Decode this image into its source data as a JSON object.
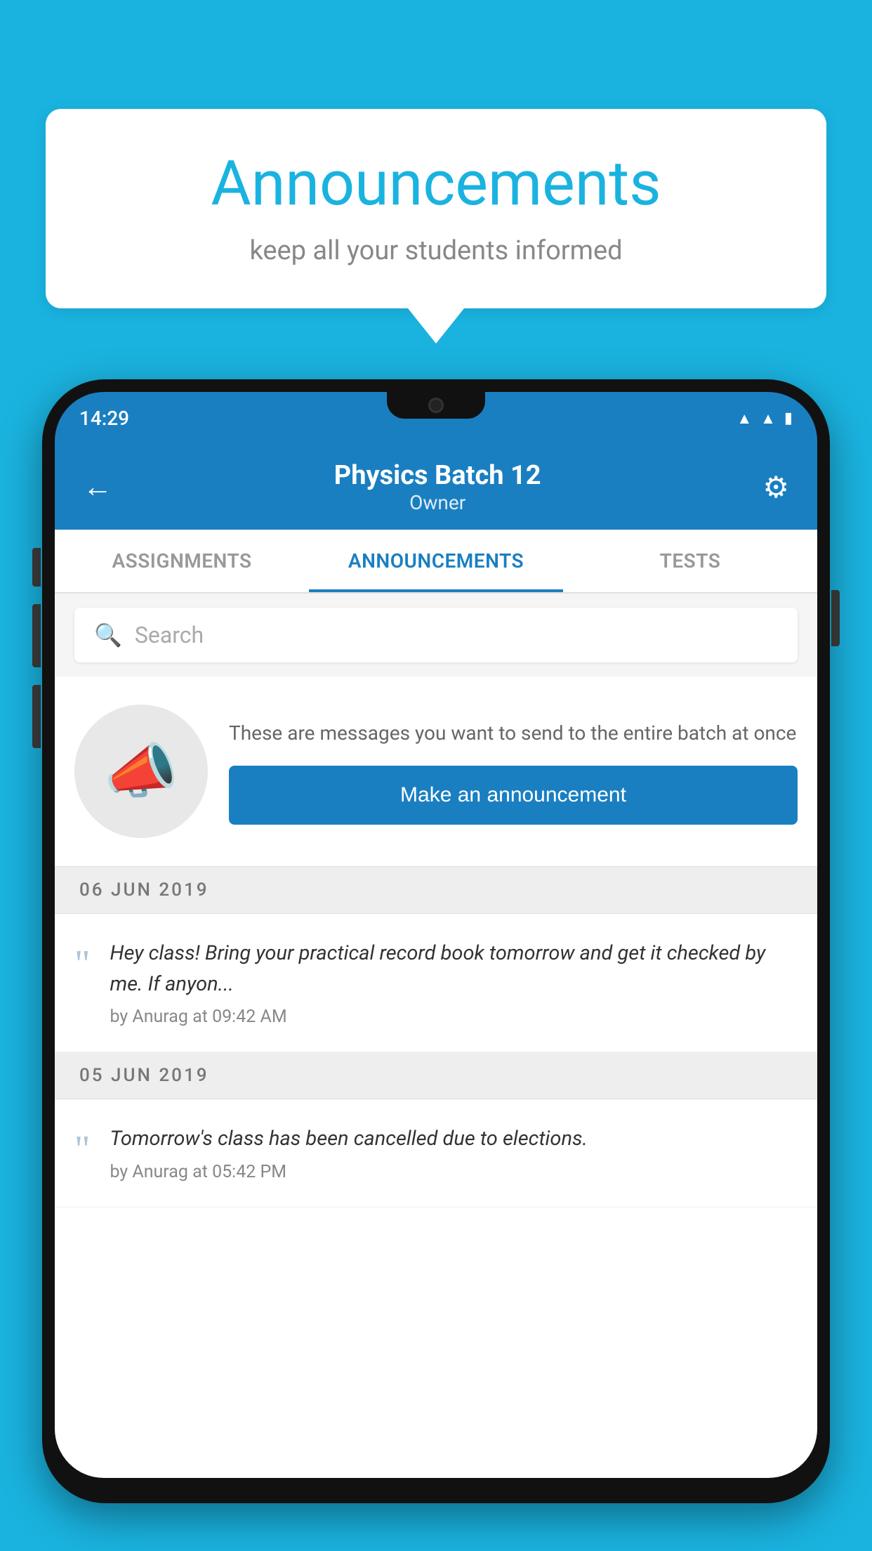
{
  "bubble": {
    "title": "Announcements",
    "subtitle": "keep all your students informed"
  },
  "status_bar": {
    "time": "14:29",
    "icons": [
      "wifi",
      "signal",
      "battery"
    ]
  },
  "header": {
    "title": "Physics Batch 12",
    "subtitle": "Owner",
    "back_label": "←",
    "settings_label": "⚙"
  },
  "tabs": [
    {
      "label": "ASSIGNMENTS",
      "active": false
    },
    {
      "label": "ANNOUNCEMENTS",
      "active": true
    },
    {
      "label": "TESTS",
      "active": false
    }
  ],
  "search": {
    "placeholder": "Search"
  },
  "announcement_prompt": {
    "description": "These are messages you want to send to the entire batch at once",
    "button_label": "Make an announcement"
  },
  "announcements": [
    {
      "date": "06  JUN  2019",
      "text": "Hey class! Bring your practical record book tomorrow and get it checked by me. If anyon...",
      "meta": "by Anurag at 09:42 AM"
    },
    {
      "date": "05  JUN  2019",
      "text": "Tomorrow's class has been cancelled due to elections.",
      "meta": "by Anurag at 05:42 PM"
    }
  ]
}
